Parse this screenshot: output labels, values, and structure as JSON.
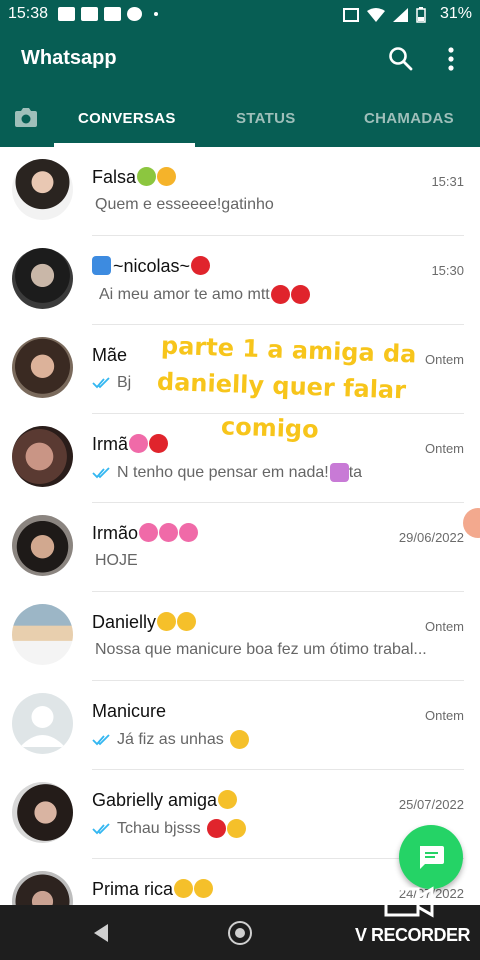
{
  "status_bar": {
    "time": "15:38",
    "battery": "31%",
    "icons": [
      "youtube-icon",
      "video-icon",
      "facebook-icon",
      "messenger-icon",
      "cast-icon",
      "wifi-icon",
      "signal-icon",
      "battery-icon"
    ]
  },
  "app": {
    "title": "Whatsapp",
    "header_color": "#075e54",
    "accent_color": "#25d366"
  },
  "tabs": [
    {
      "label": "CONVERSAS",
      "active": true
    },
    {
      "label": "STATUS",
      "active": false
    },
    {
      "label": "CHAMADAS",
      "active": false
    }
  ],
  "chats": [
    {
      "name": "Falsa",
      "time": "15:31",
      "preview": "Quem e esseeee!gatinho",
      "read_ticks": false
    },
    {
      "name": "~nicolas~",
      "time": "15:30",
      "preview": "Ai meu amor te amo mtt",
      "read_ticks": false
    },
    {
      "name": "Mãe",
      "time": "Ontem",
      "preview": "Bj",
      "read_ticks": true
    },
    {
      "name": "Irmã",
      "time": "Ontem",
      "preview": "N tenho que pensar em nada!",
      "preview_suffix": "ta",
      "read_ticks": true
    },
    {
      "name": "Irmão",
      "time": "29/06/2022",
      "preview": "HOJE",
      "read_ticks": false
    },
    {
      "name": "Danielly",
      "time": "Ontem",
      "preview": "Nossa que manicure boa fez um ótimo trabal...",
      "read_ticks": false
    },
    {
      "name": "Manicure",
      "time": "Ontem",
      "preview": "Já fiz as unhas",
      "read_ticks": true
    },
    {
      "name": "Gabrielly amiga",
      "time": "25/07/2022",
      "preview": "Tchau bjsss",
      "read_ticks": true
    },
    {
      "name": "Prima rica",
      "time": "24/07/2022",
      "preview": "",
      "read_ticks": false
    }
  ],
  "overlay": {
    "line1": "parte 1 a amiga da",
    "line2": "danielly quer falar",
    "line3": "comigo"
  },
  "watermark": "V RECORDER"
}
